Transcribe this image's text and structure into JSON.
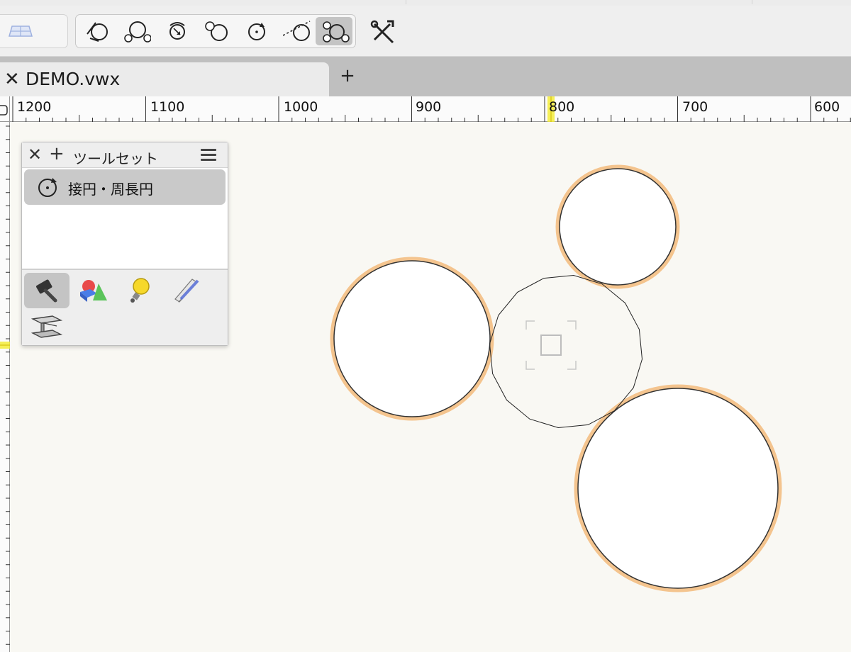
{
  "document": {
    "tab_name": "DEMO.vwx",
    "close_glyph": "✕",
    "new_tab_glyph": "+"
  },
  "toolbar": {
    "mode_tools": [
      {
        "icon": "tangent-circle-icon"
      },
      {
        "icon": "circle-by-two-circles-icon"
      },
      {
        "icon": "circle-around-icon"
      },
      {
        "icon": "overlapping-circles-icon"
      },
      {
        "icon": "circle-by-center-icon"
      },
      {
        "icon": "tangent-line-circle-icon"
      },
      {
        "icon": "three-circles-tangent-icon",
        "active": true
      }
    ],
    "settings_icon": "tool-settings-icon"
  },
  "ruler": {
    "labels": [
      "1200",
      "1100",
      "1000",
      "900",
      "800",
      "700",
      "600"
    ]
  },
  "palette": {
    "title": "ツールセット",
    "close_glyph": "✕",
    "add_glyph": "+",
    "selected_tool": "接円・周長円",
    "tool_sets": [
      {
        "icon": "hammer-icon",
        "active": true
      },
      {
        "icon": "3d-shapes-icon"
      },
      {
        "icon": "light-bulb-icon"
      },
      {
        "icon": "pencil-ruler-icon"
      },
      {
        "icon": "steel-beam-icon"
      }
    ]
  },
  "colors": {
    "canvas": "#f9f8f3",
    "highlight": "#f4c48e",
    "selection_tab": "#c4c4c4"
  }
}
